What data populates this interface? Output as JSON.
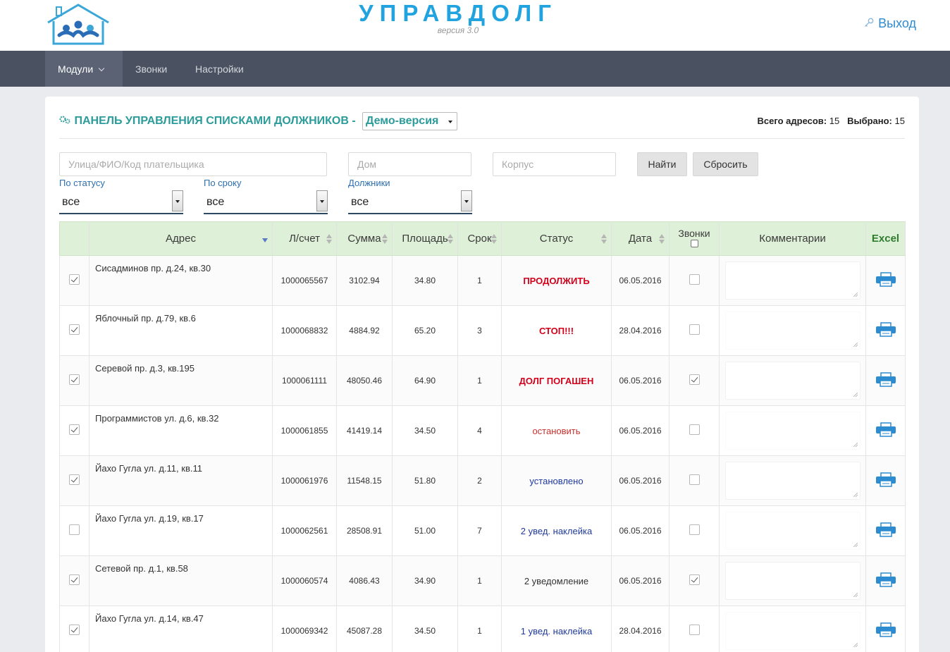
{
  "header": {
    "title": "УПРАВДОЛГ",
    "version": "версия 3.0",
    "logout_label": "Выход"
  },
  "nav": {
    "items": [
      {
        "label": "Модули",
        "active": true
      },
      {
        "label": "Звонки",
        "active": false
      },
      {
        "label": "Настройки",
        "active": false
      }
    ]
  },
  "panel": {
    "title": "ПАНЕЛЬ УПРАВЛЕНИЯ СПИСКАМИ ДОЛЖНИКОВ -",
    "mode_select": "Демо-версия",
    "total_label": "Всего адресов:",
    "total_value": "15",
    "selected_label": "Выбрано:",
    "selected_value": "15"
  },
  "filters": {
    "search_placeholder": "Улица/ФИО/Код плательщика",
    "house_placeholder": "Дом",
    "building_placeholder": "Корпус",
    "find_label": "Найти",
    "reset_label": "Сбросить",
    "status_label": "По статусу",
    "status_value": "все",
    "term_label": "По сроку",
    "term_value": "все",
    "debtors_label": "Должники",
    "debtors_value": "все"
  },
  "table": {
    "columns": {
      "address": "Адрес",
      "account": "Л/счет",
      "sum": "Сумма",
      "area": "Площадь",
      "term": "Срок",
      "status": "Статус",
      "date": "Дата",
      "calls": "Звонки",
      "comments": "Комментарии",
      "excel": "Excel"
    },
    "rows": [
      {
        "selected": true,
        "address": "Сисадминов пр. д.24, кв.30",
        "account": "1000065567",
        "sum": "3102.94",
        "area": "34.80",
        "term": "1",
        "status": "ПРОДОЛЖИТЬ",
        "status_style": "st-red-bold",
        "date": "06.05.2016",
        "call": false,
        "comment_box": true
      },
      {
        "selected": true,
        "address": "Яблочный пр. д.79, кв.6",
        "account": "1000068832",
        "sum": "4884.92",
        "area": "65.20",
        "term": "3",
        "status": "СТОП!!!",
        "status_style": "st-red-bold",
        "date": "28.04.2016",
        "call": false,
        "comment_box": false
      },
      {
        "selected": true,
        "address": "Серевой пр. д.3, кв.195",
        "account": "1000061111",
        "sum": "48050.46",
        "area": "64.90",
        "term": "1",
        "status": "ДОЛГ ПОГАШЕН",
        "status_style": "st-red-bold",
        "date": "06.05.2016",
        "call": true,
        "comment_box": true
      },
      {
        "selected": true,
        "address": "Программистов ул. д.6, кв.32",
        "account": "1000061855",
        "sum": "41419.14",
        "area": "34.50",
        "term": "4",
        "status": "остановить",
        "status_style": "st-red",
        "date": "06.05.2016",
        "call": false,
        "comment_box": false
      },
      {
        "selected": true,
        "address": "Йахо Гугла ул. д.11, кв.11",
        "account": "1000061976",
        "sum": "11548.15",
        "area": "51.80",
        "term": "2",
        "status": "установлено",
        "status_style": "st-blue",
        "date": "06.05.2016",
        "call": false,
        "comment_box": true
      },
      {
        "selected": false,
        "address": "Йахо Гугла ул. д.19, кв.17",
        "account": "1000062561",
        "sum": "28508.91",
        "area": "51.00",
        "term": "7",
        "status": "2 увед. наклейка",
        "status_style": "st-blue",
        "date": "06.05.2016",
        "call": false,
        "comment_box": false
      },
      {
        "selected": true,
        "address": "Сетевой пр. д.1, кв.58",
        "account": "1000060574",
        "sum": "4086.43",
        "area": "34.90",
        "term": "1",
        "status": "2 уведомление",
        "status_style": "st-dark",
        "date": "06.05.2016",
        "call": true,
        "comment_box": true
      },
      {
        "selected": true,
        "address": "Йахо Гугла ул. д.14, кв.47",
        "account": "1000069342",
        "sum": "45087.28",
        "area": "34.50",
        "term": "1",
        "status": "1 увед. наклейка",
        "status_style": "st-blue",
        "date": "28.04.2016",
        "call": false,
        "comment_box": false
      }
    ]
  },
  "colors": {
    "brand": "#21a3e0",
    "nav_bg": "#4a5160",
    "title_teal": "#2b9c9a",
    "header_row": "#dff0d8",
    "printer_blue": "#2d8bd0"
  }
}
